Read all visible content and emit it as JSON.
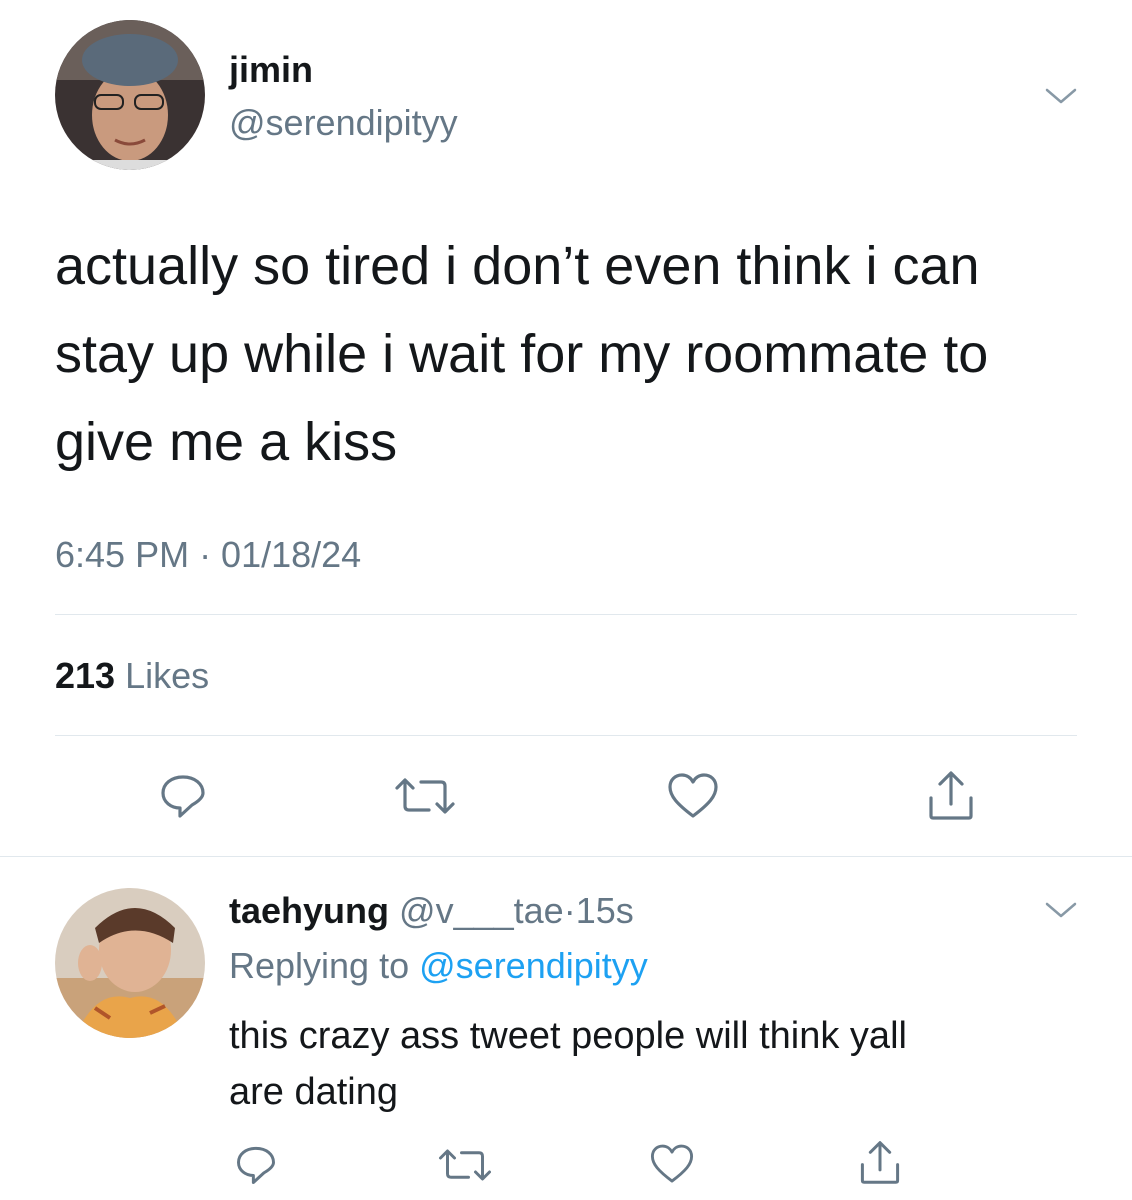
{
  "main_tweet": {
    "display_name": "jimin",
    "handle": "@serendipityy",
    "text_lines": [
      "actually so tired i don’t even think i can",
      "stay up while i wait for my roommate to",
      "give me a kiss"
    ],
    "timestamp": "6:45 PM · 01/18/24",
    "likes_count": "213",
    "likes_label": "Likes"
  },
  "reply_tweet": {
    "display_name": "taehyung",
    "handle": "@v___tae",
    "separator": "·",
    "time": "15s",
    "replying_prefix": "Replying to",
    "replying_handle": "@serendipityy",
    "text_lines": [
      "this crazy ass tweet people will think yall",
      "are dating"
    ]
  },
  "icons": {
    "menu": "chevron-down-icon",
    "reply": "reply-icon",
    "retweet": "retweet-icon",
    "like": "heart-icon",
    "share": "share-icon"
  },
  "colors": {
    "text": "#14171a",
    "muted": "#657786",
    "link": "#1da1f2",
    "divider": "#e1e8ed"
  }
}
